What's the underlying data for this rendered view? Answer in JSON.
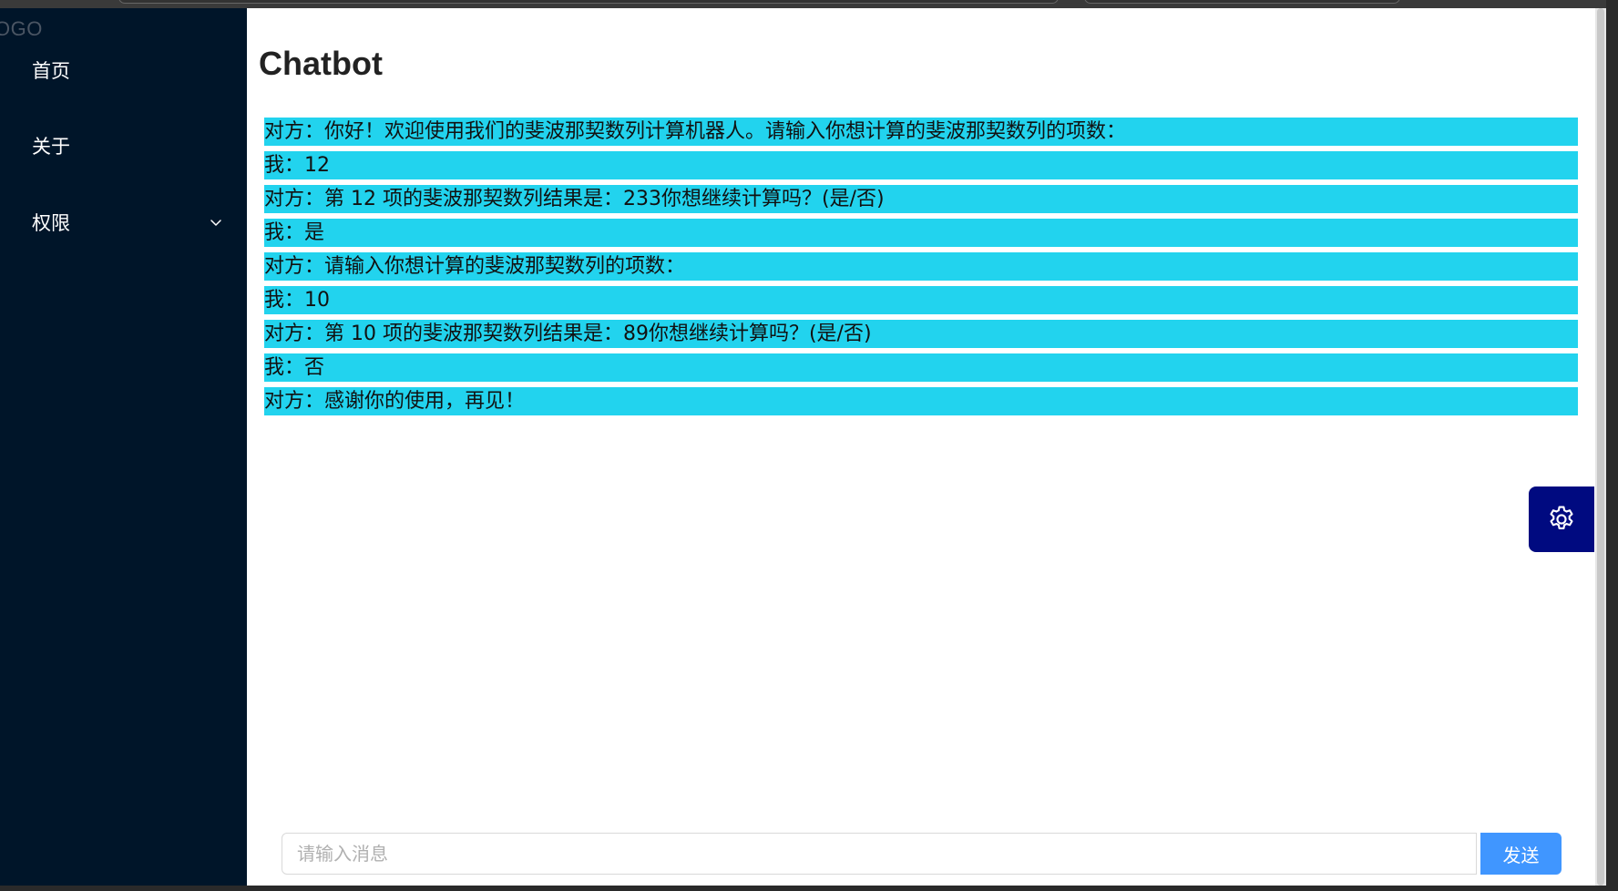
{
  "sidebar": {
    "logo": "OGO",
    "items": [
      {
        "label": "首页"
      },
      {
        "label": "关于"
      },
      {
        "label": "权限",
        "icon": "chevron-down-icon"
      }
    ]
  },
  "main": {
    "title": "Chatbot",
    "messages": [
      "对方：你好！欢迎使用我们的斐波那契数列计算机器人。请输入你想计算的斐波那契数列的项数：",
      "我：12",
      "对方：第 12 项的斐波那契数列结果是：233你想继续计算吗？(是/否)",
      "我：是",
      "对方：请输入你想计算的斐波那契数列的项数：",
      "我：10",
      "对方：第 10 项的斐波那契数列结果是：89你想继续计算吗？(是/否)",
      "我：否",
      "对方：感谢你的使用，再见！"
    ],
    "input": {
      "placeholder": "请输入消息",
      "value": ""
    },
    "send_label": "发送",
    "settings_icon": "gear-icon"
  },
  "colors": {
    "sidebar_bg": "#001529",
    "message_bg": "#22d3ee",
    "send_button": "#4096ff",
    "settings_button": "#000a80"
  }
}
